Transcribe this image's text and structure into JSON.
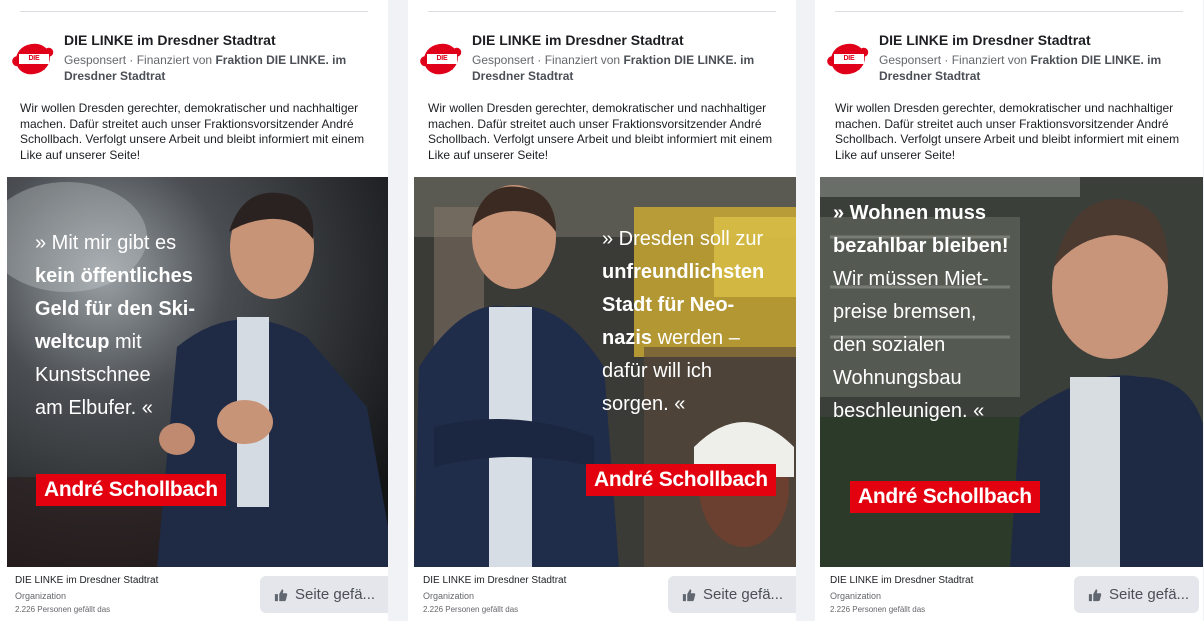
{
  "ads": [
    {
      "page_name": "DIE LINKE im Dresdner Stadtrat",
      "logo_text": "DIE LINKE.",
      "sponsored": "Gesponsert",
      "financed_prefix": "· Finanziert von",
      "financed_by": "Fraktion DIE LINKE. im Dresdner Stadtrat",
      "body": "Wir wollen Dresden gerechter, demokratischer und nachhaltiger machen. Dafür streitet auch unser Fraktionsvorsitzender André Schollbach. Verfolgt unsere Arbeit und bleibt informiert mit einem Like auf unserer Seite!",
      "quote": {
        "l1": "» Mit mir gibt es",
        "l2": "kein öffentliches",
        "l3": "Geld für den Ski-",
        "l4a": "weltcup",
        "l4b": " mit",
        "l5": "Kunstschnee",
        "l6": "am Elbufer. «"
      },
      "name_label": "André Schollbach",
      "footer_name": "DIE LINKE im Dresdner Stadtrat",
      "footer_type": "Organization",
      "footer_likes": "2.226 Personen gefällt das",
      "like_button": "Seite gefä..."
    },
    {
      "page_name": "DIE LINKE im Dresdner Stadtrat",
      "logo_text": "DIE LINKE.",
      "sponsored": "Gesponsert",
      "financed_prefix": "· Finanziert von",
      "financed_by": "Fraktion DIE LINKE. im Dresdner Stadtrat",
      "body": "Wir wollen Dresden gerechter, demokratischer und nachhaltiger machen. Dafür streitet auch unser Fraktionsvorsitzender André Schollbach. Verfolgt unsere Arbeit und bleibt informiert mit einem Like auf unserer Seite!",
      "quote": {
        "l1": "» Dresden soll zur",
        "l2": "unfreundlichsten",
        "l3": "Stadt für Neo-",
        "l4a": "nazis",
        "l4b": " werden –",
        "l5": "dafür will ich",
        "l6": "sorgen. «"
      },
      "name_label": "André Schollbach",
      "footer_name": "DIE LINKE im Dresdner Stadtrat",
      "footer_type": "Organization",
      "footer_likes": "2.226 Personen gefällt das",
      "like_button": "Seite gefä..."
    },
    {
      "page_name": "DIE LINKE im Dresdner Stadtrat",
      "logo_text": "DIE LINKE.",
      "sponsored": "Gesponsert",
      "financed_prefix": "· Finanziert von",
      "financed_by": "Fraktion DIE LINKE. im Dresdner Stadtrat",
      "body": "Wir wollen Dresden gerechter, demokratischer und nachhaltiger machen. Dafür streitet auch unser Fraktionsvorsitzender André Schollbach. Verfolgt unsere Arbeit und bleibt informiert mit einem Like auf unserer Seite!",
      "quote": {
        "l1": "» Wohnen muss",
        "l2": "bezahlbar bleiben!",
        "l3": "Wir müssen Miet-",
        "l4": "preise bremsen,",
        "l5": "den sozialen",
        "l6": "Wohnungsbau",
        "l7": "beschleunigen. «"
      },
      "name_label": "André Schollbach",
      "footer_name": "DIE LINKE im Dresdner Stadtrat",
      "footer_type": "Organization",
      "footer_likes": "2.226 Personen gefällt das",
      "like_button": "Seite gefä..."
    }
  ],
  "colors": {
    "brand_red": "#e3000f",
    "like_button_bg": "#e4e6eb",
    "page_bg": "#f0f2f5"
  },
  "icons": {
    "logo": "die-linke-logo-icon",
    "like": "thumbs-up-icon"
  }
}
